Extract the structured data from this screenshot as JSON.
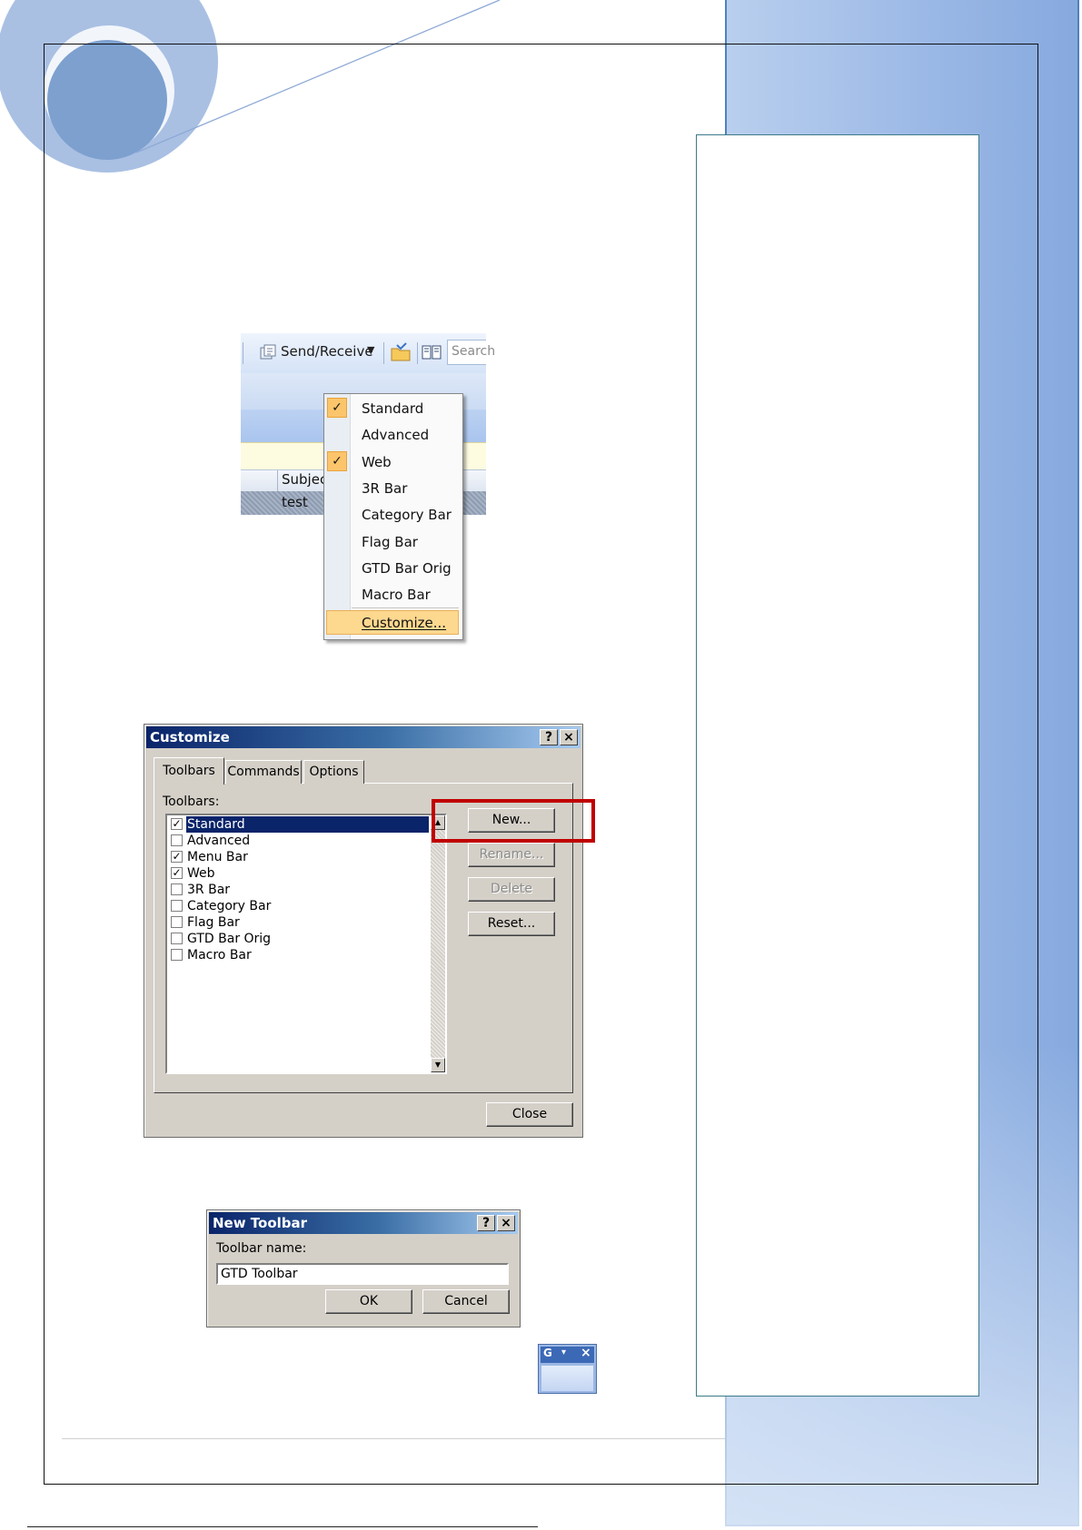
{
  "toolbar_shot": {
    "send_receive": "Send/Receive",
    "search_fragment": "Search",
    "subject_fragment": "Subjec",
    "row_value": "test",
    "menu_items": [
      {
        "label": "Standard",
        "checked": true
      },
      {
        "label": "Advanced",
        "checked": false
      },
      {
        "label": "Web",
        "checked": true
      },
      {
        "label": "3R Bar",
        "checked": false
      },
      {
        "label": "Category Bar",
        "checked": false
      },
      {
        "label": "Flag Bar",
        "checked": false
      },
      {
        "label": "GTD Bar Orig",
        "checked": false
      },
      {
        "label": "Macro Bar",
        "checked": false
      }
    ],
    "customize": "Customize..."
  },
  "customize_dialog": {
    "title": "Customize",
    "help_button": "?",
    "close_x": "×",
    "tabs": [
      "Toolbars",
      "Commands",
      "Options"
    ],
    "list_label": "Toolbars:",
    "toolbars": [
      {
        "label": "Standard",
        "checked": true,
        "selected": true
      },
      {
        "label": "Advanced",
        "checked": false,
        "selected": false
      },
      {
        "label": "Menu Bar",
        "checked": true,
        "selected": false
      },
      {
        "label": "Web",
        "checked": true,
        "selected": false
      },
      {
        "label": "3R Bar",
        "checked": false,
        "selected": false
      },
      {
        "label": "Category Bar",
        "checked": false,
        "selected": false
      },
      {
        "label": "Flag Bar",
        "checked": false,
        "selected": false
      },
      {
        "label": "GTD Bar Orig",
        "checked": false,
        "selected": false
      },
      {
        "label": "Macro Bar",
        "checked": false,
        "selected": false
      }
    ],
    "buttons": {
      "new": "New...",
      "rename": "Rename...",
      "delete": "Delete",
      "reset": "Reset...",
      "close": "Close"
    },
    "highlight_color": "#c00000"
  },
  "new_toolbar_dialog": {
    "title": "New Toolbar",
    "help_button": "?",
    "close_x": "×",
    "field_label": "Toolbar name:",
    "field_value": "GTD Toolbar",
    "ok": "OK",
    "cancel": "Cancel"
  },
  "mini_toolbar": {
    "title": "G",
    "dropdown": "▾",
    "close": "×"
  },
  "colors": {
    "sidebar": "#9cb9e6",
    "title_bar": "#0a246a",
    "dialog_face": "#d4d0c8",
    "menu_check": "#fcc56b"
  }
}
